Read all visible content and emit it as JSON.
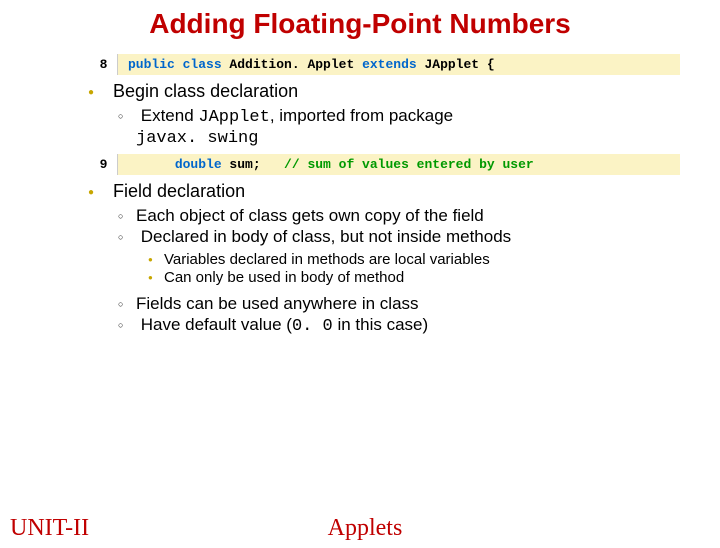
{
  "title": "Adding Floating-Point Numbers",
  "code1": {
    "num": "8",
    "kw1": "public class",
    "name": " Addition. Applet ",
    "kw2": "extends",
    "rest": " JApplet {"
  },
  "b1": {
    "heading": "Begin class declaration",
    "sub_pre": "Extend ",
    "sub_m1": "JApplet",
    "sub_mid": ", imported from package ",
    "sub_m2": "javax. swing"
  },
  "code2": {
    "num": "9",
    "indent": "      ",
    "kw1": "double",
    "mid": " sum;   ",
    "cm": "// sum of values entered by user"
  },
  "b2": {
    "heading": "Field declaration",
    "s1": "Each object of class gets own copy of the field",
    "s2": "Declared in body of class, but not inside methods",
    "t1": "Variables declared in methods are local variables",
    "t2": "Can only be used in body of method",
    "s3": "Fields can be used anywhere in class",
    "s4_pre": "Have default value (",
    "s4_m": "0. 0",
    "s4_post": " in this case)"
  },
  "footer": {
    "unit": "UNIT-II",
    "mid": "Applets"
  }
}
